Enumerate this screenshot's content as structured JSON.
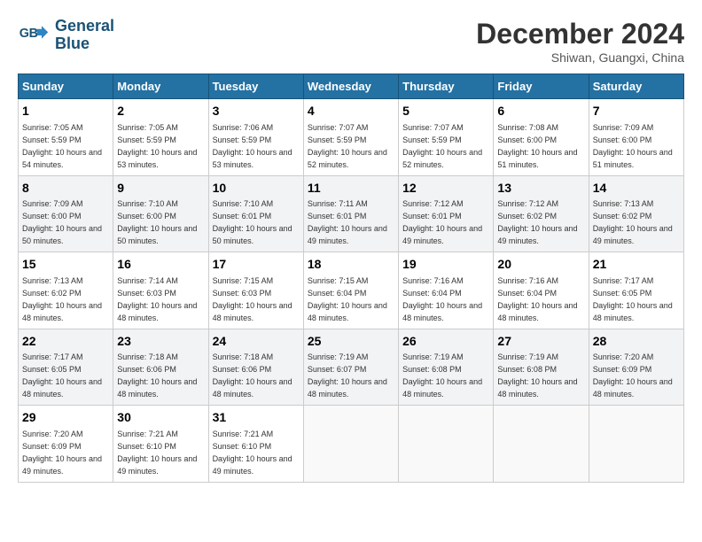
{
  "logo": {
    "line1": "General",
    "line2": "Blue"
  },
  "title": "December 2024",
  "subtitle": "Shiwan, Guangxi, China",
  "days_header": [
    "Sunday",
    "Monday",
    "Tuesday",
    "Wednesday",
    "Thursday",
    "Friday",
    "Saturday"
  ],
  "weeks": [
    [
      {
        "day": "1",
        "sunrise": "7:05 AM",
        "sunset": "5:59 PM",
        "daylight": "10 hours and 54 minutes."
      },
      {
        "day": "2",
        "sunrise": "7:05 AM",
        "sunset": "5:59 PM",
        "daylight": "10 hours and 53 minutes."
      },
      {
        "day": "3",
        "sunrise": "7:06 AM",
        "sunset": "5:59 PM",
        "daylight": "10 hours and 53 minutes."
      },
      {
        "day": "4",
        "sunrise": "7:07 AM",
        "sunset": "5:59 PM",
        "daylight": "10 hours and 52 minutes."
      },
      {
        "day": "5",
        "sunrise": "7:07 AM",
        "sunset": "5:59 PM",
        "daylight": "10 hours and 52 minutes."
      },
      {
        "day": "6",
        "sunrise": "7:08 AM",
        "sunset": "6:00 PM",
        "daylight": "10 hours and 51 minutes."
      },
      {
        "day": "7",
        "sunrise": "7:09 AM",
        "sunset": "6:00 PM",
        "daylight": "10 hours and 51 minutes."
      }
    ],
    [
      {
        "day": "8",
        "sunrise": "7:09 AM",
        "sunset": "6:00 PM",
        "daylight": "10 hours and 50 minutes."
      },
      {
        "day": "9",
        "sunrise": "7:10 AM",
        "sunset": "6:00 PM",
        "daylight": "10 hours and 50 minutes."
      },
      {
        "day": "10",
        "sunrise": "7:10 AM",
        "sunset": "6:01 PM",
        "daylight": "10 hours and 50 minutes."
      },
      {
        "day": "11",
        "sunrise": "7:11 AM",
        "sunset": "6:01 PM",
        "daylight": "10 hours and 49 minutes."
      },
      {
        "day": "12",
        "sunrise": "7:12 AM",
        "sunset": "6:01 PM",
        "daylight": "10 hours and 49 minutes."
      },
      {
        "day": "13",
        "sunrise": "7:12 AM",
        "sunset": "6:02 PM",
        "daylight": "10 hours and 49 minutes."
      },
      {
        "day": "14",
        "sunrise": "7:13 AM",
        "sunset": "6:02 PM",
        "daylight": "10 hours and 49 minutes."
      }
    ],
    [
      {
        "day": "15",
        "sunrise": "7:13 AM",
        "sunset": "6:02 PM",
        "daylight": "10 hours and 48 minutes."
      },
      {
        "day": "16",
        "sunrise": "7:14 AM",
        "sunset": "6:03 PM",
        "daylight": "10 hours and 48 minutes."
      },
      {
        "day": "17",
        "sunrise": "7:15 AM",
        "sunset": "6:03 PM",
        "daylight": "10 hours and 48 minutes."
      },
      {
        "day": "18",
        "sunrise": "7:15 AM",
        "sunset": "6:04 PM",
        "daylight": "10 hours and 48 minutes."
      },
      {
        "day": "19",
        "sunrise": "7:16 AM",
        "sunset": "6:04 PM",
        "daylight": "10 hours and 48 minutes."
      },
      {
        "day": "20",
        "sunrise": "7:16 AM",
        "sunset": "6:04 PM",
        "daylight": "10 hours and 48 minutes."
      },
      {
        "day": "21",
        "sunrise": "7:17 AM",
        "sunset": "6:05 PM",
        "daylight": "10 hours and 48 minutes."
      }
    ],
    [
      {
        "day": "22",
        "sunrise": "7:17 AM",
        "sunset": "6:05 PM",
        "daylight": "10 hours and 48 minutes."
      },
      {
        "day": "23",
        "sunrise": "7:18 AM",
        "sunset": "6:06 PM",
        "daylight": "10 hours and 48 minutes."
      },
      {
        "day": "24",
        "sunrise": "7:18 AM",
        "sunset": "6:06 PM",
        "daylight": "10 hours and 48 minutes."
      },
      {
        "day": "25",
        "sunrise": "7:19 AM",
        "sunset": "6:07 PM",
        "daylight": "10 hours and 48 minutes."
      },
      {
        "day": "26",
        "sunrise": "7:19 AM",
        "sunset": "6:08 PM",
        "daylight": "10 hours and 48 minutes."
      },
      {
        "day": "27",
        "sunrise": "7:19 AM",
        "sunset": "6:08 PM",
        "daylight": "10 hours and 48 minutes."
      },
      {
        "day": "28",
        "sunrise": "7:20 AM",
        "sunset": "6:09 PM",
        "daylight": "10 hours and 48 minutes."
      }
    ],
    [
      {
        "day": "29",
        "sunrise": "7:20 AM",
        "sunset": "6:09 PM",
        "daylight": "10 hours and 49 minutes."
      },
      {
        "day": "30",
        "sunrise": "7:21 AM",
        "sunset": "6:10 PM",
        "daylight": "10 hours and 49 minutes."
      },
      {
        "day": "31",
        "sunrise": "7:21 AM",
        "sunset": "6:10 PM",
        "daylight": "10 hours and 49 minutes."
      },
      null,
      null,
      null,
      null
    ]
  ]
}
